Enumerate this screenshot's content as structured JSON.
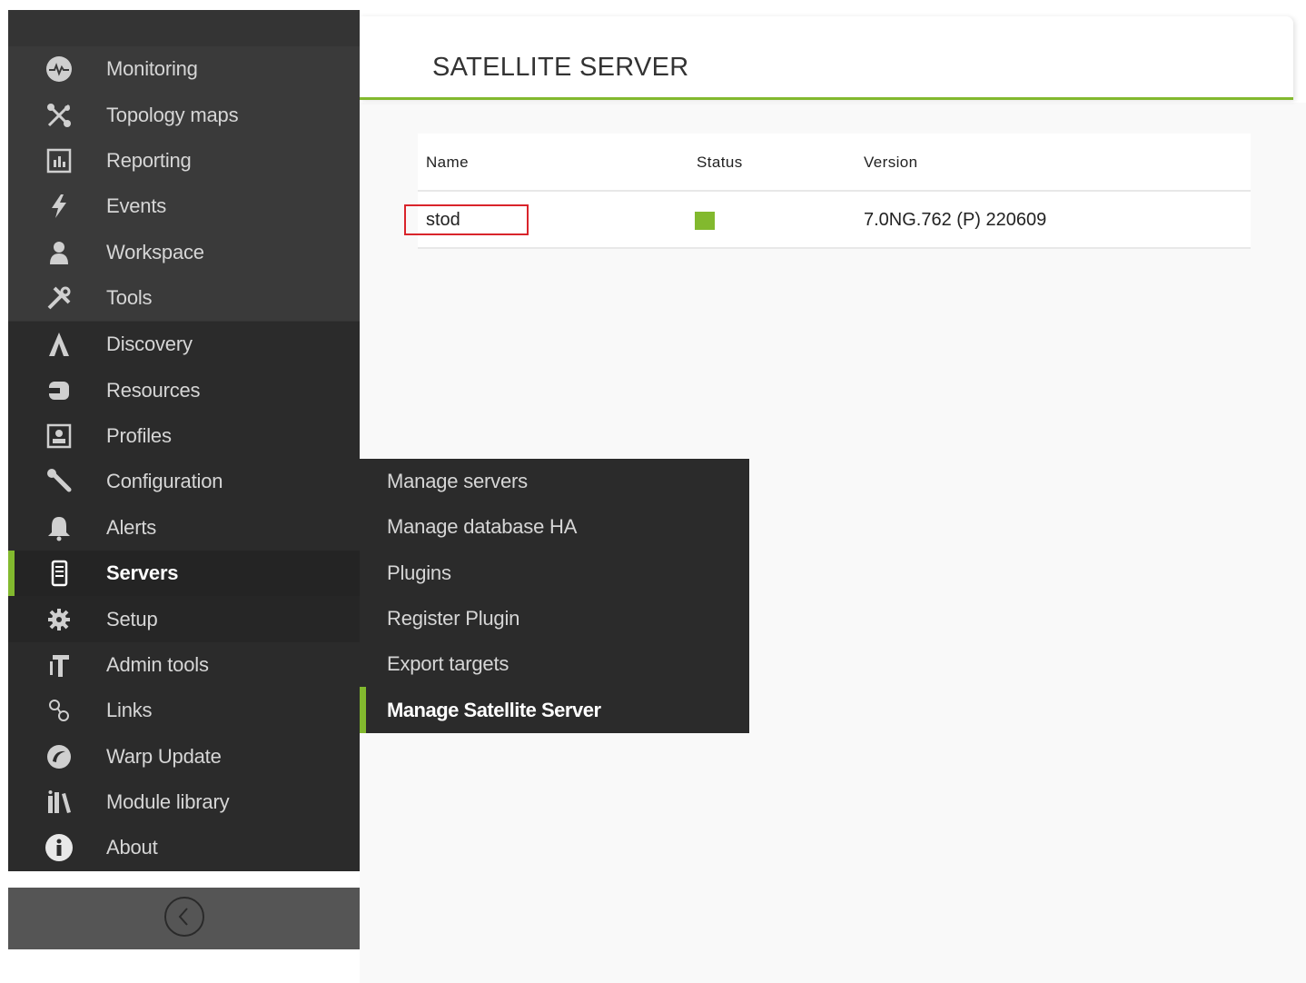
{
  "sidebar": {
    "operation_items": [
      {
        "label": "Monitoring",
        "icon": "monitoring-icon"
      },
      {
        "label": "Topology maps",
        "icon": "topology-icon"
      },
      {
        "label": "Reporting",
        "icon": "reporting-icon"
      },
      {
        "label": "Events",
        "icon": "events-bolt-icon"
      },
      {
        "label": "Workspace",
        "icon": "workspace-user-icon"
      },
      {
        "label": "Tools",
        "icon": "tools-icon"
      }
    ],
    "management_items": [
      {
        "label": "Discovery",
        "icon": "discovery-icon"
      },
      {
        "label": "Resources",
        "icon": "resources-icon"
      },
      {
        "label": "Profiles",
        "icon": "profiles-icon"
      },
      {
        "label": "Configuration",
        "icon": "wrench-icon"
      },
      {
        "label": "Alerts",
        "icon": "bell-icon"
      },
      {
        "label": "Servers",
        "icon": "server-icon"
      },
      {
        "label": "Setup",
        "icon": "gear-icon"
      },
      {
        "label": "Admin tools",
        "icon": "admin-tools-icon"
      },
      {
        "label": "Links",
        "icon": "links-icon"
      },
      {
        "label": "Warp Update",
        "icon": "warp-update-icon"
      },
      {
        "label": "Module library",
        "icon": "library-icon"
      },
      {
        "label": "About",
        "icon": "info-icon"
      }
    ],
    "collapse_icon": "chevron-left-circle-icon"
  },
  "submenu": {
    "items": [
      "Manage servers",
      "Manage database HA",
      "Plugins",
      "Register Plugin",
      "Export targets",
      "Manage Satellite Server"
    ]
  },
  "page": {
    "title": "SATELLITE SERVER"
  },
  "table": {
    "headers": {
      "name": "Name",
      "status": "Status",
      "version": "Version"
    },
    "rows": [
      {
        "name": "stod",
        "status_color": "#82b92e",
        "version": "7.0NG.762 (P) 220609"
      }
    ]
  },
  "colors": {
    "accent": "#82b92e",
    "sidebar_bg": "#343434",
    "highlight_border": "#d9242b"
  }
}
